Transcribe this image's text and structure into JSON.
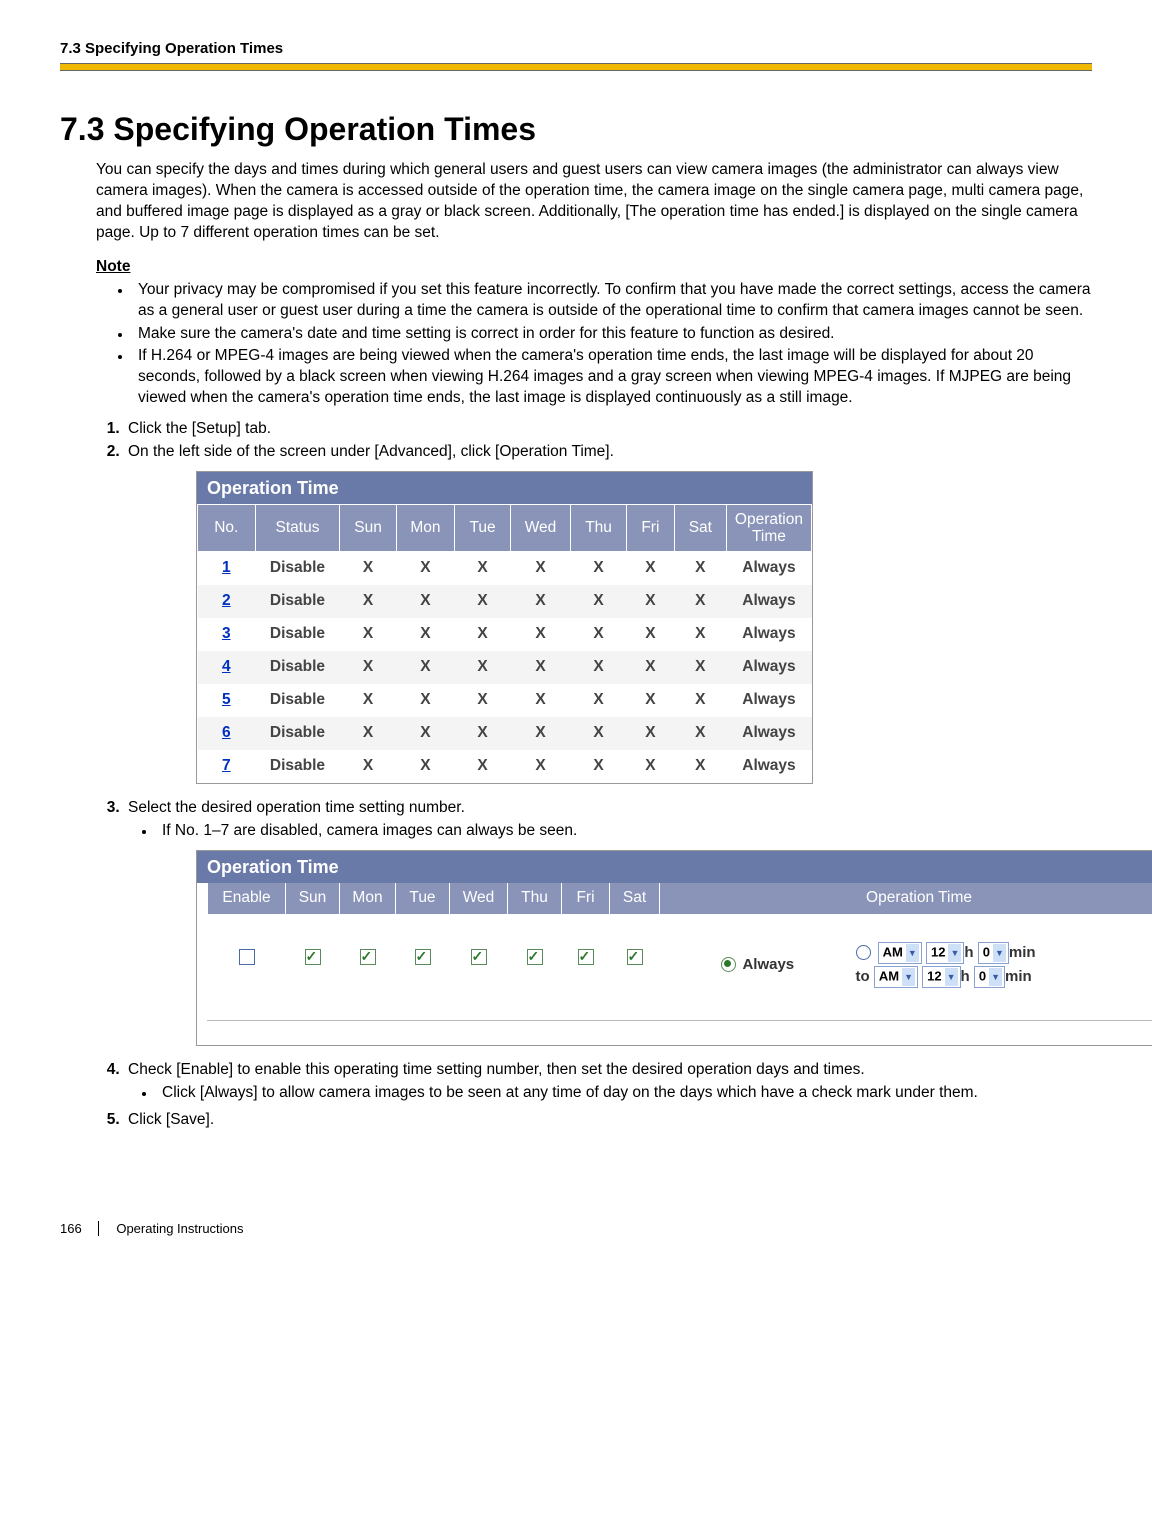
{
  "header": {
    "running_title": "7.3 Specifying Operation Times"
  },
  "section": {
    "number_title": "7.3  Specifying Operation Times",
    "intro": "You can specify the days and times during which general users and guest users can view camera images (the administrator can always view camera images). When the camera is accessed outside of the operation time, the camera image on the single camera page, multi camera page, and buffered image page is displayed as a gray or black screen. Additionally, [The operation time has ended.] is displayed on the single camera page. Up to 7 different operation times can be set.",
    "note_label": "Note",
    "notes": [
      "Your privacy may be compromised if you set this feature incorrectly. To confirm that you have made the correct settings, access the camera as a general user or guest user during a time the camera is outside of the operational time to confirm that camera images cannot be seen.",
      "Make sure the camera's date and time setting is correct in order for this feature to function as desired.",
      "If H.264 or MPEG-4 images are being viewed when the camera's operation time ends, the last image will be displayed for about 20 seconds, followed by a black screen when viewing H.264 images and a gray screen when viewing MPEG-4 images. If MJPEG are being viewed when the camera's operation time ends, the last image is displayed continuously as a still image."
    ],
    "steps": {
      "s1": "Click the [Setup] tab.",
      "s2": "On the left side of the screen under [Advanced], click [Operation Time].",
      "s3": "Select the desired operation time setting number.",
      "s3_sub": "If No. 1–7 are disabled, camera images can always be seen.",
      "s4": "Check [Enable] to enable this operating time setting number, then set the desired operation days and times.",
      "s4_sub": "Click [Always] to allow camera images to be seen at any time of day on the days which have a check mark under them.",
      "s5": "Click [Save]."
    }
  },
  "table1": {
    "title": "Operation Time",
    "headers": {
      "no": "No.",
      "status": "Status",
      "sun": "Sun",
      "mon": "Mon",
      "tue": "Tue",
      "wed": "Wed",
      "thu": "Thu",
      "fri": "Fri",
      "sat": "Sat",
      "optime": "Operation Time"
    },
    "rows": [
      {
        "no": "1",
        "status": "Disable",
        "sun": "X",
        "mon": "X",
        "tue": "X",
        "wed": "X",
        "thu": "X",
        "fri": "X",
        "sat": "X",
        "optime": "Always"
      },
      {
        "no": "2",
        "status": "Disable",
        "sun": "X",
        "mon": "X",
        "tue": "X",
        "wed": "X",
        "thu": "X",
        "fri": "X",
        "sat": "X",
        "optime": "Always"
      },
      {
        "no": "3",
        "status": "Disable",
        "sun": "X",
        "mon": "X",
        "tue": "X",
        "wed": "X",
        "thu": "X",
        "fri": "X",
        "sat": "X",
        "optime": "Always"
      },
      {
        "no": "4",
        "status": "Disable",
        "sun": "X",
        "mon": "X",
        "tue": "X",
        "wed": "X",
        "thu": "X",
        "fri": "X",
        "sat": "X",
        "optime": "Always"
      },
      {
        "no": "5",
        "status": "Disable",
        "sun": "X",
        "mon": "X",
        "tue": "X",
        "wed": "X",
        "thu": "X",
        "fri": "X",
        "sat": "X",
        "optime": "Always"
      },
      {
        "no": "6",
        "status": "Disable",
        "sun": "X",
        "mon": "X",
        "tue": "X",
        "wed": "X",
        "thu": "X",
        "fri": "X",
        "sat": "X",
        "optime": "Always"
      },
      {
        "no": "7",
        "status": "Disable",
        "sun": "X",
        "mon": "X",
        "tue": "X",
        "wed": "X",
        "thu": "X",
        "fri": "X",
        "sat": "X",
        "optime": "Always"
      }
    ]
  },
  "table2": {
    "title": "Operation Time",
    "headers": {
      "enable": "Enable",
      "sun": "Sun",
      "mon": "Mon",
      "tue": "Tue",
      "wed": "Wed",
      "thu": "Thu",
      "fri": "Fri",
      "sat": "Sat",
      "optime": "Operation Time"
    },
    "always_label": "Always",
    "time": {
      "from_ampm": "AM",
      "from_h": "12",
      "from_m": "0",
      "to_label": "to",
      "to_ampm": "AM",
      "to_h": "12",
      "to_m": "0",
      "h_label": "h",
      "min_label": "min"
    }
  },
  "footer": {
    "page": "166",
    "doc": "Operating Instructions"
  }
}
